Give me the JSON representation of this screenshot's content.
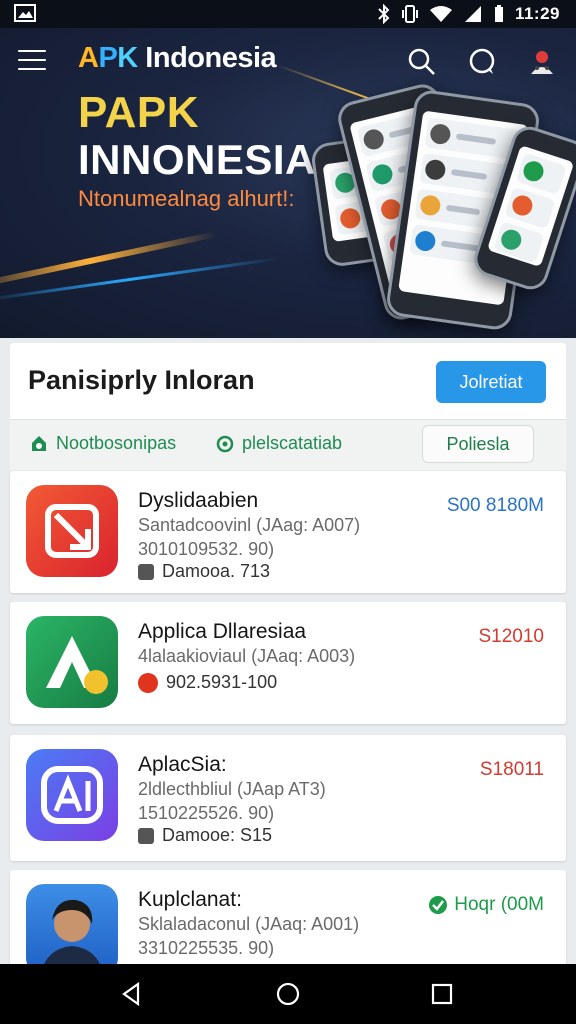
{
  "status_bar": {
    "time": "11:29"
  },
  "header": {
    "brand_a": "A",
    "brand_p": "P",
    "brand_k": "K",
    "brand_rest": " Indonesia",
    "icons": [
      "menu-icon",
      "search-icon",
      "chat-icon",
      "profile-icon"
    ]
  },
  "hero": {
    "title_line1": "PAPK",
    "title_line2": "INNONESIA",
    "subtitle": "Ntonumealnag alhurt!:"
  },
  "section": {
    "title": "Panisiprly  Inloran",
    "action_label": "Jolretiat"
  },
  "filters": {
    "item1": "Nootbosonipas",
    "item2": "plelscatatiab",
    "button": "Poliesla"
  },
  "apps": [
    {
      "name": "Dyslidaabien",
      "line1": "Santadcoovinl (JAag: A007)",
      "line2": "3010109532. 90)",
      "meta": "Damooa. 713",
      "price": "S00 8180M",
      "price_color": "#2a73c9",
      "icon_bg": "#e8452f"
    },
    {
      "name": "Applica Dllaresiaa",
      "line1": "4lalaakioviaul (JAaq: A003)",
      "line2": "",
      "meta": "902.5931-100",
      "price": "S12010",
      "price_color": "#d43a2f",
      "icon_bg": "#1f9a55"
    },
    {
      "name": "AplacSia:",
      "line1": "2ldlecthbliul (JAap AT3)",
      "line2": "1510225526. 90)",
      "meta": "Damooe: S15",
      "price": "S18011",
      "price_color": "#d43a2f",
      "icon_bg": "#5b4cf0"
    },
    {
      "name": "Kuplclanat:",
      "line1": "Sklaladaconul (JAaq: A001)",
      "line2": "3310225535. 90)",
      "meta": "",
      "price": "Hoqr (00M",
      "price_color": "#1e9b4b",
      "icon_bg": "#2b6fd6"
    }
  ],
  "colors": {
    "accent_blue": "#2997e8",
    "filter_green": "#1f8c52",
    "hero_yellow": "#f3d34a",
    "hero_orange": "#ff8a3d"
  }
}
